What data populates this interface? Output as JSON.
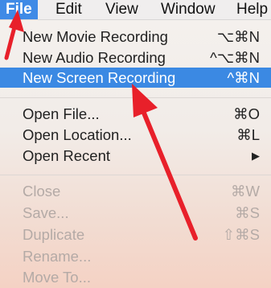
{
  "menubar": {
    "items": [
      "File",
      "Edit",
      "View",
      "Window",
      "Help"
    ]
  },
  "file_menu": {
    "items": [
      {
        "label": "New Movie Recording",
        "shortcut": "⌥⌘N"
      },
      {
        "label": "New Audio Recording",
        "shortcut": "^⌥⌘N"
      },
      {
        "label": "New Screen Recording",
        "shortcut": "^⌘N",
        "highlighted": true
      },
      {
        "label": "Open File...",
        "shortcut": "⌘O"
      },
      {
        "label": "Open Location...",
        "shortcut": "⌘L"
      },
      {
        "label": "Open Recent",
        "shortcut": "▶"
      },
      {
        "label": "Close",
        "shortcut": "⌘W",
        "disabled": true
      },
      {
        "label": "Save...",
        "shortcut": "⌘S",
        "disabled": true
      },
      {
        "label": "Duplicate",
        "shortcut": "⇧⌘S",
        "disabled": true
      },
      {
        "label": "Rename...",
        "shortcut": "",
        "disabled": true
      },
      {
        "label": "Move To...",
        "shortcut": "",
        "disabled": true
      }
    ]
  },
  "colors": {
    "highlight": "#3b89e3",
    "annotation_arrow": "#e8202a",
    "disabled_text": "#b4aaa6"
  },
  "annotations": {
    "icon": "red-arrow-icon"
  }
}
